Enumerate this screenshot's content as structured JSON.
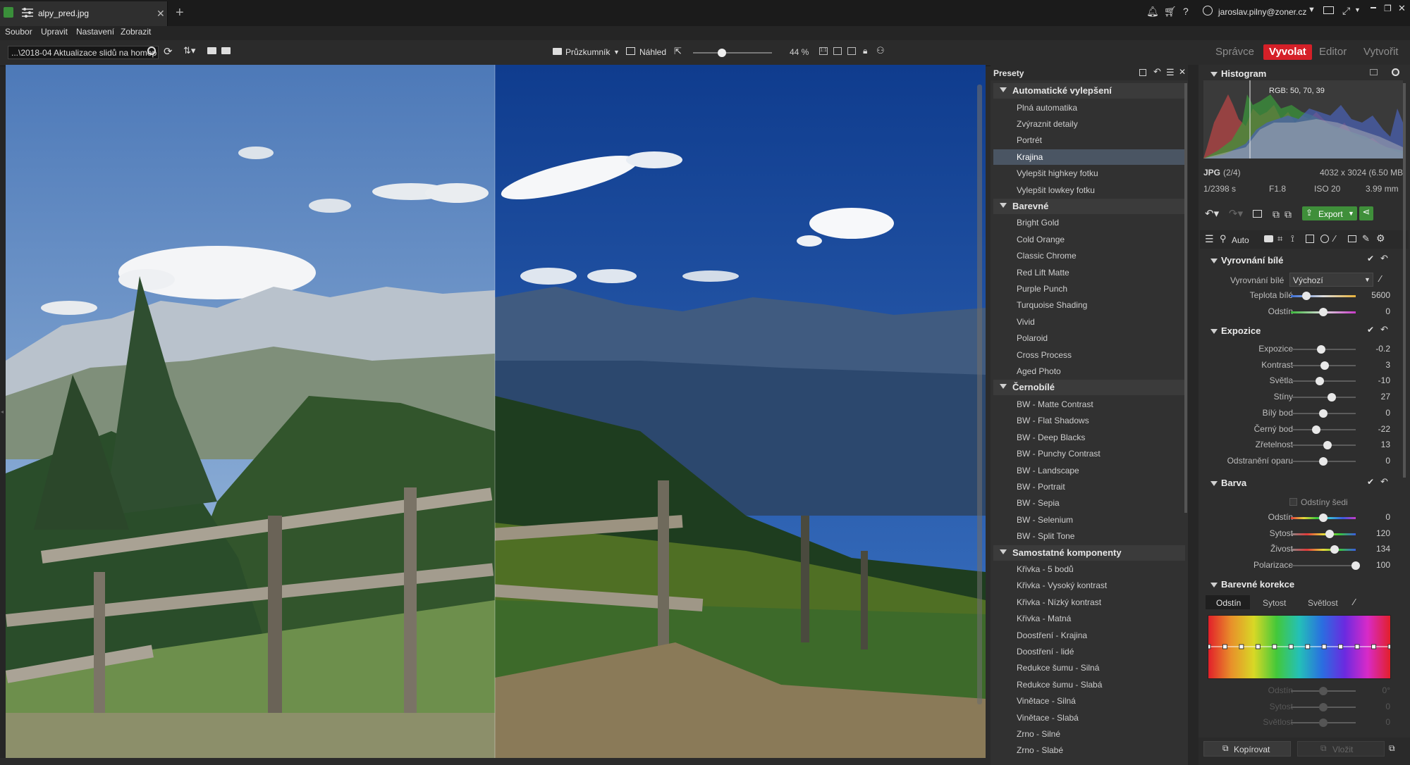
{
  "app": {
    "tab_title": "alpy_pred.jpg",
    "user": "jaroslav.pilny@zoner.cz"
  },
  "menu": [
    "Soubor",
    "Upravit",
    "Nastavení",
    "Zobrazit"
  ],
  "toolbar": {
    "path": "...\\2018-04 Aktualizace slidů na homep",
    "browser_label": "Průzkumník",
    "preview_label": "Náhled",
    "zoom": "44 %"
  },
  "modes": [
    "Správce",
    "Vyvolat",
    "Editor",
    "Vytvořit"
  ],
  "active_mode": "Vyvolat",
  "presets": {
    "title": "Presety",
    "categories": [
      {
        "name": "Automatické vylepšení",
        "items": [
          "Plná automatika",
          "Zvýraznit detaily",
          "Portrét",
          "Krajina",
          "Vylepšit highkey fotku",
          "Vylepšit lowkey fotku"
        ]
      },
      {
        "name": "Barevné",
        "items": [
          "Bright Gold",
          "Cold Orange",
          "Classic Chrome",
          "Red Lift Matte",
          "Purple Punch",
          "Turquoise Shading",
          "Vivid",
          "Polaroid",
          "Cross Process",
          "Aged Photo"
        ]
      },
      {
        "name": "Černobílé",
        "items": [
          "BW - Matte Contrast",
          "BW - Flat Shadows",
          "BW - Deep Blacks",
          "BW - Punchy Contrast",
          "BW - Landscape",
          "BW - Portrait",
          "BW - Sepia",
          "BW - Selenium",
          "BW - Split Tone"
        ]
      },
      {
        "name": "Samostatné komponenty",
        "items": [
          "Křivka - 5 bodů",
          "Křivka - Vysoký kontrast",
          "Křivka - Nízký kontrast",
          "Křivka - Matná",
          "Doostření - Krajina",
          "Doostření - lidé",
          "Redukce šumu - Silná",
          "Redukce šumu - Slabá",
          "Vinětace - Silná",
          "Vinětace - Slabá",
          "Zrno - Silné",
          "Zrno - Slabé"
        ]
      }
    ],
    "selected": "Krajina"
  },
  "histogram": {
    "title": "Histogram",
    "rgb": "RGB: 50, 70, 39"
  },
  "info": {
    "format": "JPG",
    "index": "(2/4)",
    "dimensions": "4032 x 3024 (6.50 MB)",
    "shutter": "1/2398 s",
    "aperture": "F1.8",
    "iso": "ISO 20",
    "focal": "3.99 mm"
  },
  "tools": {
    "export_label": "Export",
    "auto_label": "Auto"
  },
  "white_balance": {
    "title": "Vyrovnání bílé",
    "mode_label": "Vyrovnání bílé",
    "mode_value": "Výchozí",
    "sliders": [
      {
        "label": "Teplota bílé",
        "value": "5600",
        "pos": 0.24
      },
      {
        "label": "Odstín",
        "value": "0",
        "pos": 0.5
      }
    ]
  },
  "exposure": {
    "title": "Expozice",
    "sliders": [
      {
        "label": "Expozice",
        "value": "-0.2",
        "pos": 0.47
      },
      {
        "label": "Kontrast",
        "value": "3",
        "pos": 0.52
      },
      {
        "label": "Světla",
        "value": "-10",
        "pos": 0.45
      },
      {
        "label": "Stíny",
        "value": "27",
        "pos": 0.63
      },
      {
        "label": "Bílý bod",
        "value": "0",
        "pos": 0.5
      },
      {
        "label": "Černý bod",
        "value": "-22",
        "pos": 0.39
      },
      {
        "label": "Zřetelnost",
        "value": "13",
        "pos": 0.57
      },
      {
        "label": "Odstranění oparu",
        "value": "0",
        "pos": 0.5
      }
    ]
  },
  "color": {
    "title": "Barva",
    "grayscale_label": "Odstíny šedi",
    "sliders": [
      {
        "label": "Odstín",
        "value": "0",
        "pos": 0.5
      },
      {
        "label": "Sytost",
        "value": "120",
        "pos": 0.6
      },
      {
        "label": "Živost",
        "value": "134",
        "pos": 0.67
      },
      {
        "label": "Polarizace",
        "value": "100",
        "pos": 1.0
      }
    ]
  },
  "color_corrections": {
    "title": "Barevné korekce",
    "tabs": [
      "Odstín",
      "Sytost",
      "Světlost"
    ],
    "active_tab": "Odstín",
    "sliders": [
      {
        "label": "Odstín",
        "value": "0°",
        "pos": 0.5
      },
      {
        "label": "Sytost",
        "value": "0",
        "pos": 0.5
      },
      {
        "label": "Světlost",
        "value": "0",
        "pos": 0.5
      }
    ]
  },
  "footer": {
    "copy_label": "Kopírovat",
    "paste_label": "Vložit"
  }
}
